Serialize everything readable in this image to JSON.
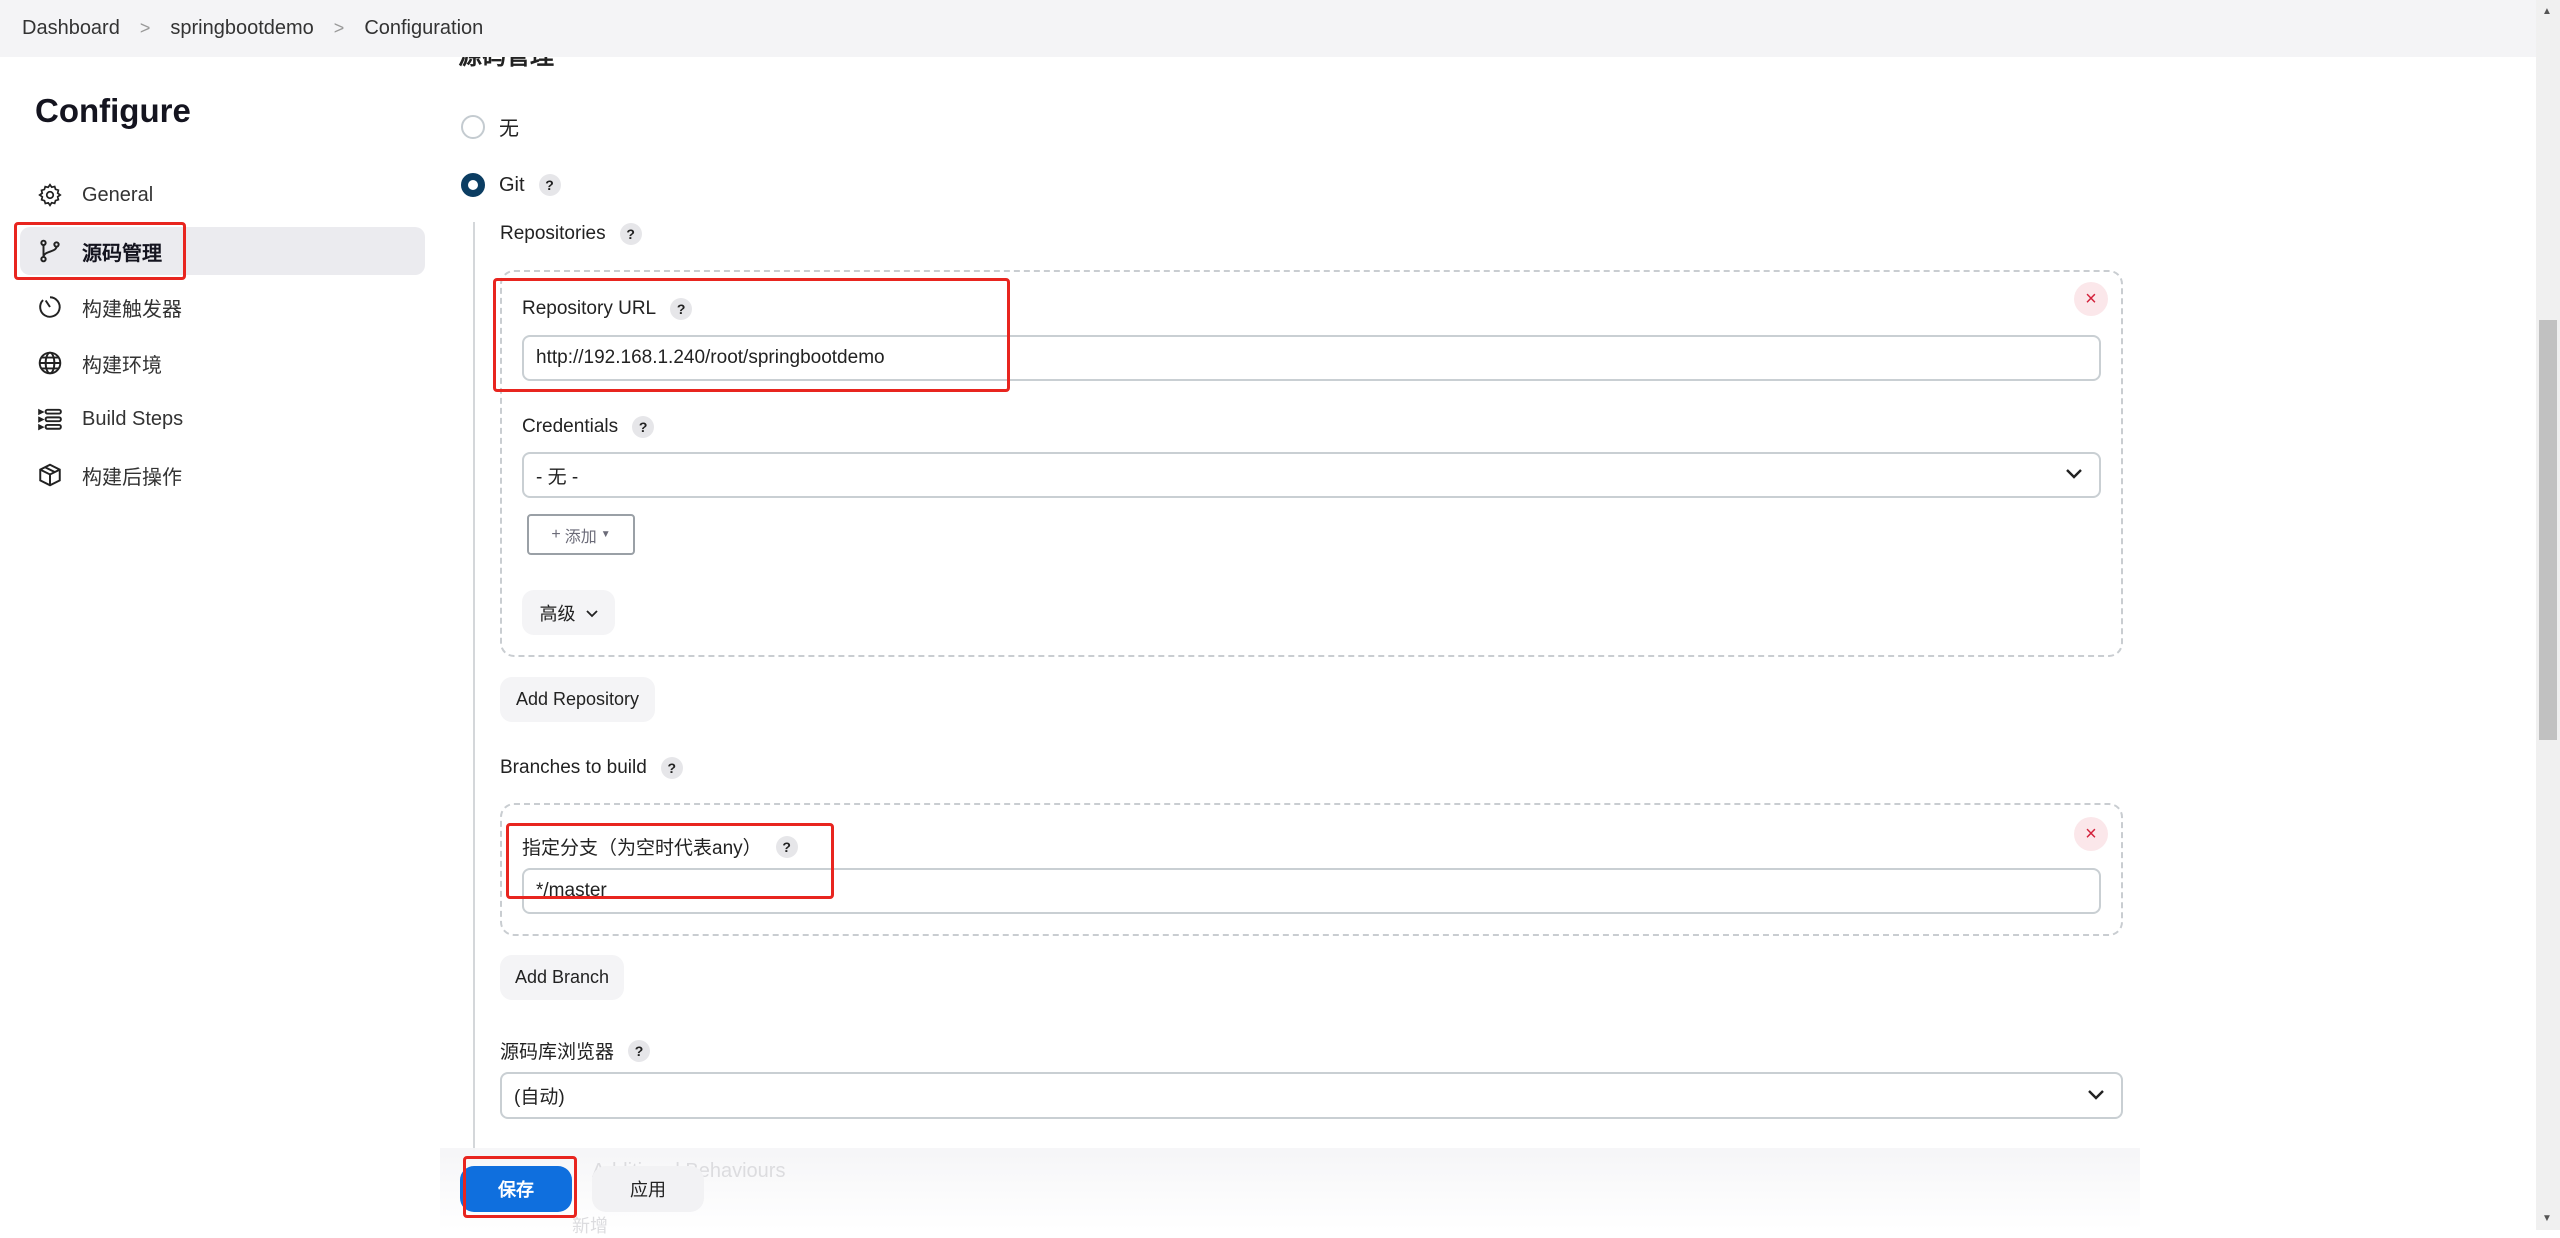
{
  "breadcrumb": [
    "Dashboard",
    "springbootdemo",
    "Configuration"
  ],
  "breadcrumb_separator": ">",
  "section_title": "源码管理",
  "sidebar": {
    "title": "Configure",
    "items": [
      {
        "label": "General",
        "icon": "gear-icon"
      },
      {
        "label": "源码管理",
        "icon": "branch-icon",
        "active": true
      },
      {
        "label": "构建触发器",
        "icon": "clock-icon"
      },
      {
        "label": "构建环境",
        "icon": "globe-icon"
      },
      {
        "label": "Build Steps",
        "icon": "list-icon"
      },
      {
        "label": "构建后操作",
        "icon": "package-icon"
      }
    ]
  },
  "scm": {
    "options": [
      {
        "label": "无",
        "selected": false
      },
      {
        "label": "Git",
        "selected": true
      }
    ],
    "help": "?",
    "repositories_label": "Repositories",
    "repository": {
      "url_label": "Repository URL",
      "url_value": "http://192.168.1.240/root/springbootdemo",
      "credentials_label": "Credentials",
      "credentials_value": "- 无 -",
      "add_label": "添加",
      "advanced_label": "高级",
      "remove": "×"
    },
    "add_repository_label": "Add Repository",
    "branches_label": "Branches to build",
    "branch": {
      "label": "指定分支（为空时代表any）",
      "value": "*/master",
      "remove": "×"
    },
    "add_branch_label": "Add Branch",
    "browser_label": "源码库浏览器",
    "browser_value": "(自动)",
    "behind_text": "Additional Behaviours",
    "behind_add": "新增"
  },
  "footer": {
    "save_label": "保存",
    "apply_label": "应用"
  },
  "colors": {
    "accent": "#0f6fde",
    "radio_selected": "#0b3d62",
    "highlight_box": "#e8251f",
    "remove": "#d3213b"
  }
}
